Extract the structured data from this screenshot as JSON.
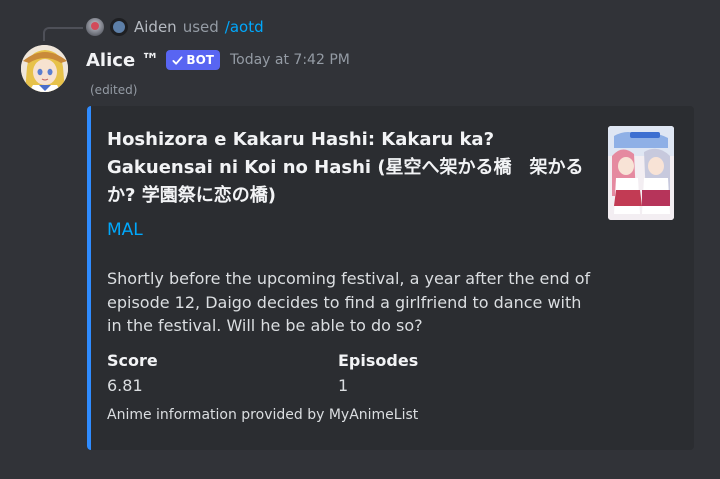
{
  "reply": {
    "user": "Aiden",
    "used_text": "used",
    "command": "/aotd",
    "icons": [
      "user-mini-avatar",
      "slash-command-icon"
    ]
  },
  "message": {
    "author": "Alice ™",
    "bot_tag": "BOT",
    "bot_check_icon": "checkmark-icon",
    "timestamp": "Today at 7:42 PM",
    "edited": "(edited)"
  },
  "embed": {
    "accent_color": "#2f8cff",
    "title": "Hoshizora e Kakaru Hashi: Kakaru ka? Gakuensai ni Koi no Hashi (星空へ架かる橋　架かるか? 学園祭に恋の橋)",
    "link_label": "MAL",
    "description": "Shortly before the upcoming festival, a year after the end of episode 12, Daigo decides to find a girlfriend to dance with in the festival. Will he be able to do so?",
    "fields": [
      {
        "name": "Score",
        "value": "6.81"
      },
      {
        "name": "Episodes",
        "value": "1"
      }
    ],
    "footer": "Anime information provided by MyAnimeList",
    "thumbnail_icon": "anime-cover-thumbnail"
  },
  "colors": {
    "background": "#313338",
    "embed_background": "#2b2d31",
    "link": "#00a8fc",
    "bot_tag": "#5865f2"
  }
}
